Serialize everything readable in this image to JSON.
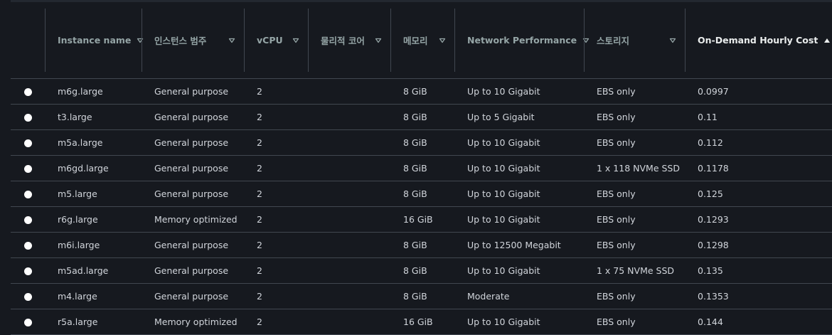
{
  "columns": [
    {
      "key": "name",
      "label": "Instance name",
      "sort": "desc"
    },
    {
      "key": "category",
      "label": "인스턴스 범주",
      "sort": "desc"
    },
    {
      "key": "vcpu",
      "label": "vCPU",
      "sort": "desc"
    },
    {
      "key": "cores",
      "label": "물리적 코어",
      "sort": "desc"
    },
    {
      "key": "memory",
      "label": "메모리",
      "sort": "desc"
    },
    {
      "key": "network",
      "label": "Network Performance",
      "sort": "desc"
    },
    {
      "key": "storage",
      "label": "스토리지",
      "sort": "desc"
    },
    {
      "key": "cost",
      "label": "On-Demand Hourly Cost",
      "sort": "asc",
      "active": true
    }
  ],
  "rows": [
    {
      "name": "m6g.large",
      "category": "General purpose",
      "vcpu": "2",
      "cores": "",
      "memory": "8 GiB",
      "network": "Up to 10 Gigabit",
      "storage": "EBS only",
      "cost": "0.0997"
    },
    {
      "name": "t3.large",
      "category": "General purpose",
      "vcpu": "2",
      "cores": "",
      "memory": "8 GiB",
      "network": "Up to 5 Gigabit",
      "storage": "EBS only",
      "cost": "0.11"
    },
    {
      "name": "m5a.large",
      "category": "General purpose",
      "vcpu": "2",
      "cores": "",
      "memory": "8 GiB",
      "network": "Up to 10 Gigabit",
      "storage": "EBS only",
      "cost": "0.112"
    },
    {
      "name": "m6gd.large",
      "category": "General purpose",
      "vcpu": "2",
      "cores": "",
      "memory": "8 GiB",
      "network": "Up to 10 Gigabit",
      "storage": "1 x 118 NVMe SSD",
      "cost": "0.1178"
    },
    {
      "name": "m5.large",
      "category": "General purpose",
      "vcpu": "2",
      "cores": "",
      "memory": "8 GiB",
      "network": "Up to 10 Gigabit",
      "storage": "EBS only",
      "cost": "0.125"
    },
    {
      "name": "r6g.large",
      "category": "Memory optimized",
      "vcpu": "2",
      "cores": "",
      "memory": "16 GiB",
      "network": "Up to 10 Gigabit",
      "storage": "EBS only",
      "cost": "0.1293"
    },
    {
      "name": "m6i.large",
      "category": "General purpose",
      "vcpu": "2",
      "cores": "",
      "memory": "8 GiB",
      "network": "Up to 12500 Megabit",
      "storage": "EBS only",
      "cost": "0.1298"
    },
    {
      "name": "m5ad.large",
      "category": "General purpose",
      "vcpu": "2",
      "cores": "",
      "memory": "8 GiB",
      "network": "Up to 10 Gigabit",
      "storage": "1 x 75 NVMe SSD",
      "cost": "0.135"
    },
    {
      "name": "m4.large",
      "category": "General purpose",
      "vcpu": "2",
      "cores": "",
      "memory": "8 GiB",
      "network": "Moderate",
      "storage": "EBS only",
      "cost": "0.1353"
    },
    {
      "name": "r5a.large",
      "category": "Memory optimized",
      "vcpu": "2",
      "cores": "",
      "memory": "16 GiB",
      "network": "Up to 10 Gigabit",
      "storage": "EBS only",
      "cost": "0.144"
    }
  ],
  "icons": {
    "sort_desc": "caret-down-outline-icon",
    "sort_asc": "caret-up-filled-icon",
    "row_select": "radio-button-icon"
  },
  "colors": {
    "background": "#16191f",
    "header_text": "#95a5a6",
    "active_header_text": "#eaeded",
    "cell_text": "#d1d5db",
    "divider": "#414750"
  }
}
